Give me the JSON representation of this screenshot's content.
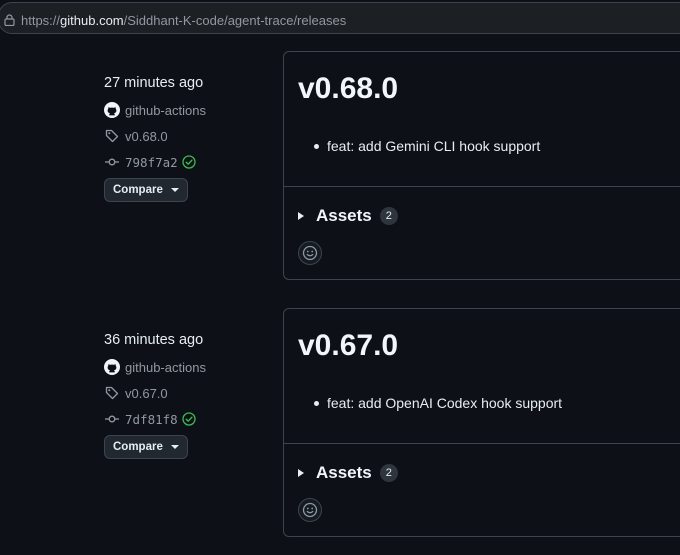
{
  "browser": {
    "url_prefix": "https://",
    "url_host": "github.com",
    "url_path": "/Siddhant-K-code/agent-trace/releases"
  },
  "releases": [
    {
      "time": "27 minutes ago",
      "author": "github-actions",
      "tag": "v0.68.0",
      "commit": "798f7a2",
      "compare_label": "Compare",
      "title": "v0.68.0",
      "notes": [
        "feat: add Gemini CLI hook support"
      ],
      "assets_label": "Assets",
      "assets_count": "2"
    },
    {
      "time": "36 minutes ago",
      "author": "github-actions",
      "tag": "v0.67.0",
      "commit": "7df81f8",
      "compare_label": "Compare",
      "title": "v0.67.0",
      "notes": [
        "feat: add OpenAI Codex hook support"
      ],
      "assets_label": "Assets",
      "assets_count": "2"
    }
  ],
  "icons": {
    "lock": "lock-icon",
    "author": "github-logo-icon",
    "tag": "tag-icon",
    "commit": "git-commit-icon",
    "verified": "check-circle-icon",
    "reaction": "smiley-icon"
  },
  "colors": {
    "background": "#0d1117",
    "border": "#3d444d",
    "muted_text": "#9198a1",
    "verified_green": "#3fb950"
  }
}
